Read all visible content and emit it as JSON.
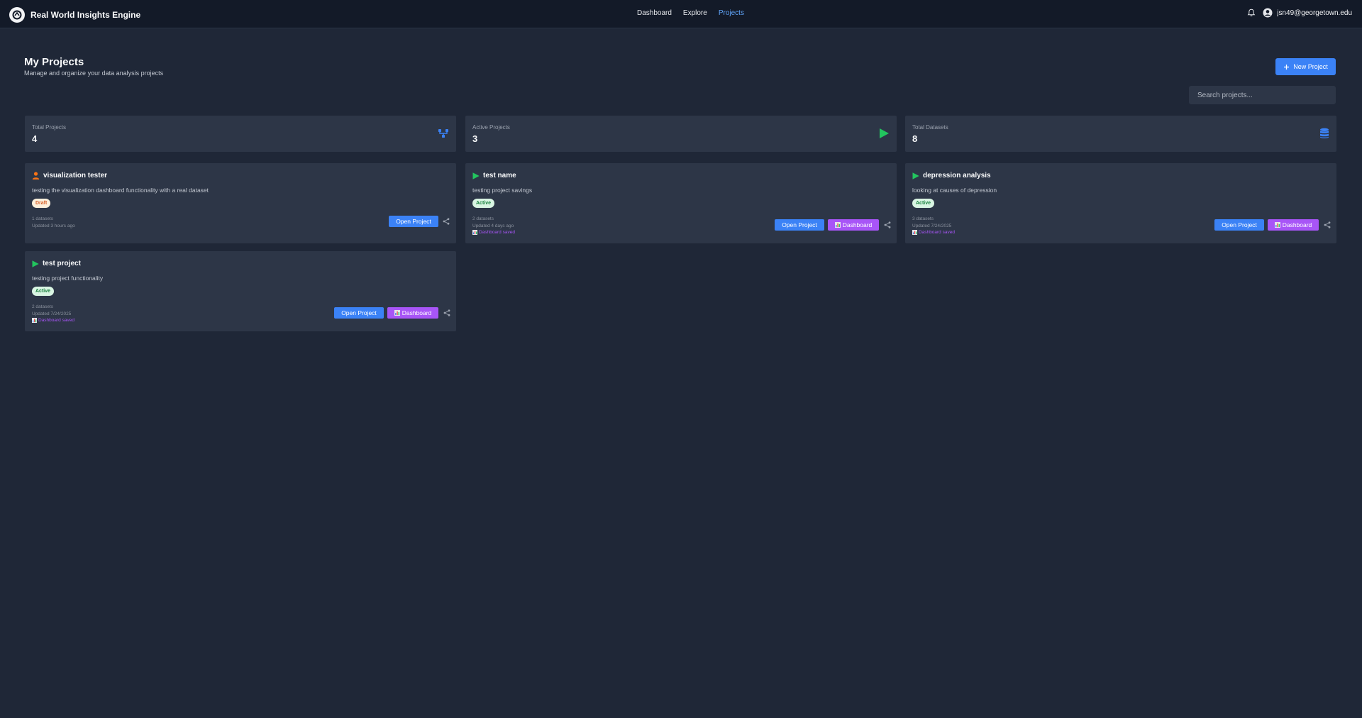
{
  "app": {
    "title": "Real World Insights Engine",
    "nav": [
      "Dashboard",
      "Explore",
      "Projects"
    ],
    "active_nav": "Projects",
    "user_email": "jsn49@georgetown.edu"
  },
  "header": {
    "title": "My Projects",
    "subtitle": "Manage and organize your data analysis projects",
    "new_project_label": "New Project",
    "search_placeholder": "Search projects..."
  },
  "stats": [
    {
      "label": "Total Projects",
      "value": "4",
      "icon": "git-branch-icon",
      "color": "#3b82f6"
    },
    {
      "label": "Active Projects",
      "value": "3",
      "icon": "play-icon",
      "color": "#22c55e"
    },
    {
      "label": "Total Datasets",
      "value": "8",
      "icon": "database-icon",
      "color": "#3b82f6"
    }
  ],
  "projects": [
    {
      "name": "visualization tester",
      "icon": "user-icon",
      "description": "testing the visualization dashboard functionality with a real dataset",
      "status": "Draft",
      "datasets": "1 datasets",
      "updated": "Updated 3 hours ago",
      "dashboard_saved": ""
    },
    {
      "name": "test name",
      "icon": "play-icon",
      "description": "testing project savings",
      "status": "Active",
      "datasets": "2 datasets",
      "updated": "Updated 4 days ago",
      "dashboard_saved": "Dashboard saved"
    },
    {
      "name": "depression analysis",
      "icon": "play-icon",
      "description": "looking at causes of depression",
      "status": "Active",
      "datasets": "3 datasets",
      "updated": "Updated 7/24/2025",
      "dashboard_saved": "Dashboard saved"
    },
    {
      "name": "test project",
      "icon": "play-icon",
      "description": "testing project functionality",
      "status": "Active",
      "datasets": "2 datasets",
      "updated": "Updated 7/24/2025",
      "dashboard_saved": "Dashboard saved"
    }
  ],
  "labels": {
    "open_project": "Open Project",
    "dashboard": "Dashboard"
  },
  "colors": {
    "background": "#1f2737",
    "card": "#2d3647",
    "primary": "#3b82f6",
    "purple": "#a855f7",
    "green": "#22c55e",
    "orange": "#f97316"
  }
}
